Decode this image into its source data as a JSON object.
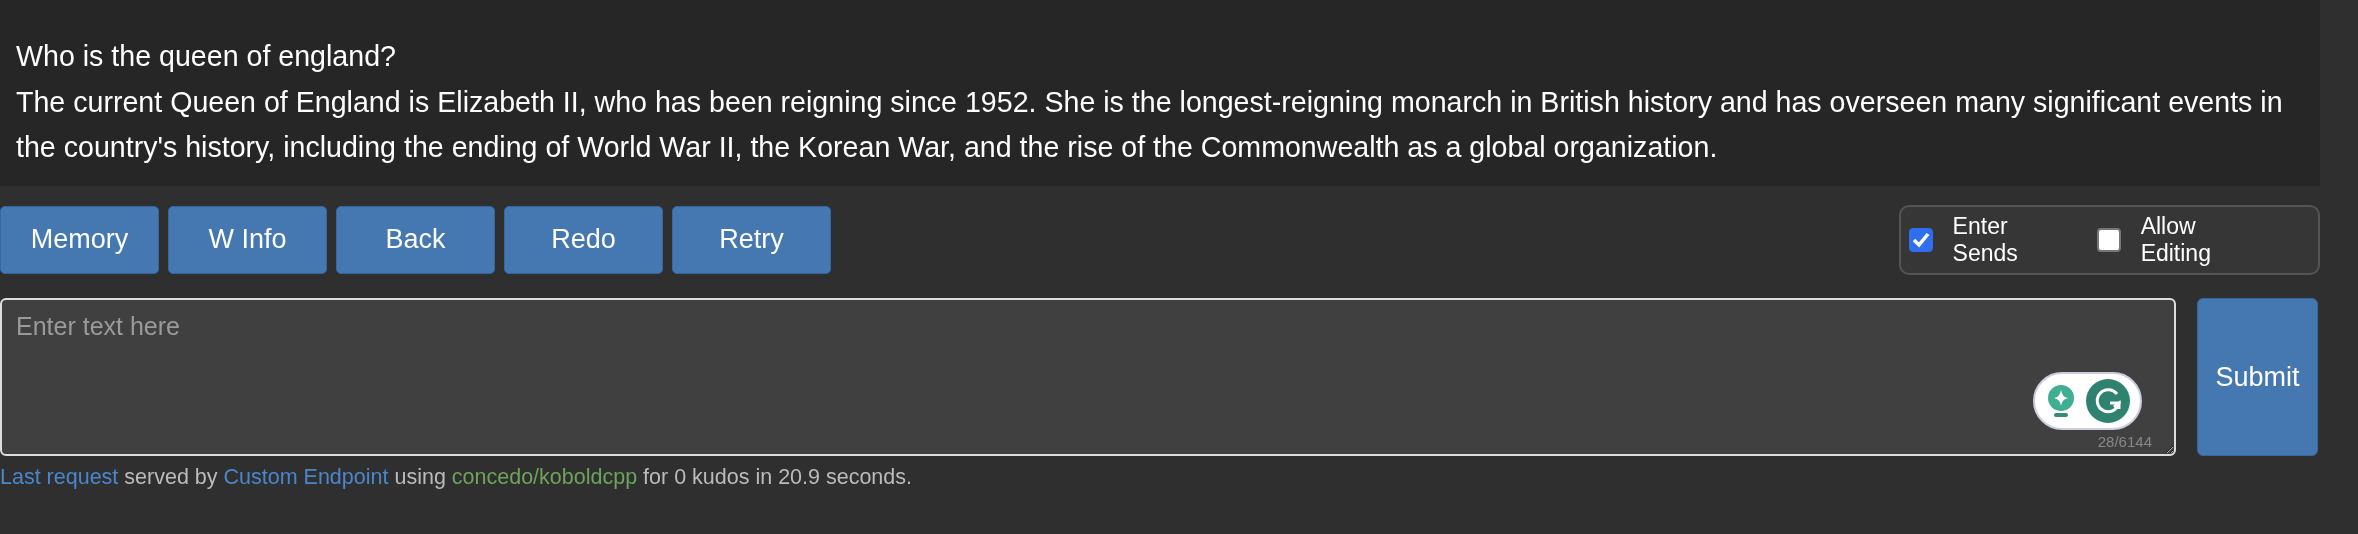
{
  "story": {
    "prompt": "Who is the queen of england?",
    "response": "The current Queen of England is Elizabeth II, who has been reigning since 1952. She is the longest-reigning monarch in British history and has overseen many significant events in the country's history, including the ending of World War II, the Korean War, and the rise of the Commonwealth as a global organization."
  },
  "buttons": [
    "Memory",
    "W Info",
    "Back",
    "Redo",
    "Retry"
  ],
  "options": [
    {
      "label": "Enter Sends",
      "checked": true
    },
    {
      "label": "Allow Editing",
      "checked": false
    }
  ],
  "input": {
    "placeholder": "Enter text here",
    "counter": "28/6144"
  },
  "submit": "Submit",
  "status": [
    {
      "kind": "link",
      "text": "Last request"
    },
    {
      "kind": "text",
      "text": "served by"
    },
    {
      "kind": "link",
      "text": "Custom Endpoint"
    },
    {
      "kind": "text",
      "text": "using"
    },
    {
      "kind": "model",
      "text": "concedo/koboldcpp"
    },
    {
      "kind": "text",
      "text": "for 0 kudos in 20.9 seconds."
    }
  ]
}
